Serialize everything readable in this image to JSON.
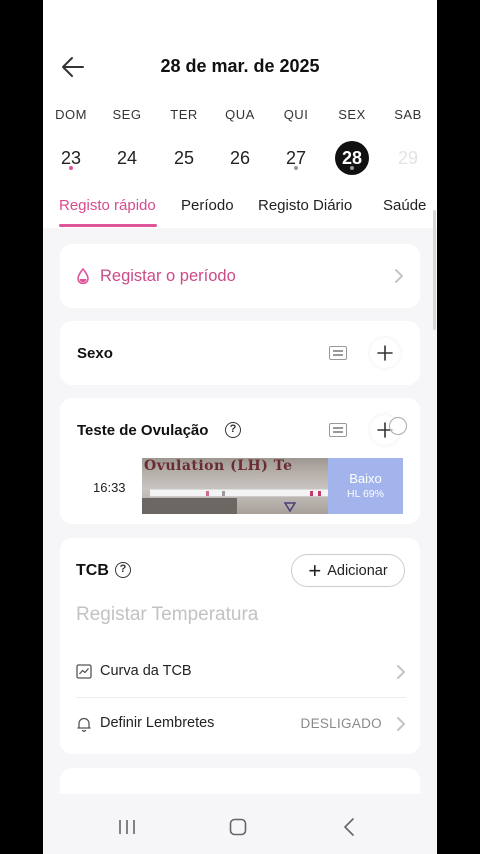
{
  "header": {
    "title": "28 de mar. de 2025",
    "back_icon": "arrow-left-icon"
  },
  "calendar": {
    "weekdays": [
      "DOM",
      "SEG",
      "TER",
      "QUA",
      "QUI",
      "SEX",
      "SAB"
    ],
    "days": [
      "23",
      "24",
      "25",
      "26",
      "27",
      "28",
      "29"
    ],
    "selected_day": "28",
    "dot_colors": {
      "period": "#e0559a",
      "log": "#999999"
    }
  },
  "tabs": [
    "Registo rápido",
    "Período",
    "Registo Diário",
    "Saúde"
  ],
  "active_tab": "Registo rápido",
  "period_card": {
    "label": "Registar o período",
    "icon": "drop-icon"
  },
  "sex_card": {
    "title": "Sexo"
  },
  "ovulation_card": {
    "title": "Teste de Ovulação",
    "entry": {
      "time": "16:33",
      "photo_text": "Ovulation (LH) Te",
      "result_level": "Baixo",
      "result_value": "HL 69%"
    }
  },
  "tcb_card": {
    "title": "TCB",
    "add_label": "Adicionar",
    "placeholder": "Registar Temperatura",
    "rows": [
      {
        "label": "Curva da TCB",
        "value": "",
        "icon": "chart-icon"
      },
      {
        "label": "Definir Lembretes",
        "value": "DESLIGADO",
        "icon": "bell-icon"
      }
    ]
  },
  "colors": {
    "accent": "#e0559a",
    "accent_text": "#cc4a88",
    "result_bg": "#a3b4ec",
    "background": "#f6f5f7"
  }
}
